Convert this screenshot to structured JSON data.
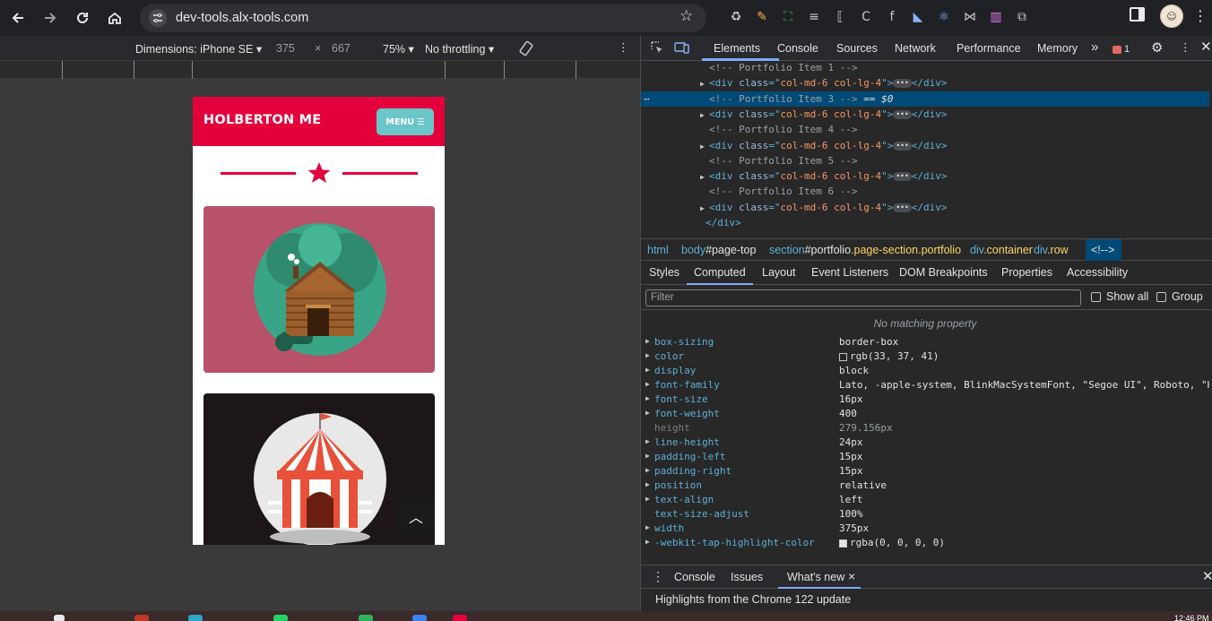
{
  "browser": {
    "url": "dev-tools.alx-tools.com"
  },
  "device_toolbar": {
    "dimensions_label": "Dimensions: iPhone SE",
    "width": "375",
    "times": "×",
    "height": "667",
    "zoom": "75%",
    "throttling": "No throttling"
  },
  "page": {
    "brand": "HOLBERTON ME",
    "menu_label": "MENU",
    "portfolio_colors": [
      "#b8516a",
      "#1c1716"
    ]
  },
  "devtools": {
    "tabs": [
      "Elements",
      "Console",
      "Sources",
      "Network",
      "Performance",
      "Memory"
    ],
    "more_tabs": "»",
    "error_count": "1",
    "dom_lines": [
      {
        "type": "comment",
        "text": "<!-- Portfolio Item 1 -->",
        "indent": 0,
        "arrow": false
      },
      {
        "type": "element",
        "tag": "div",
        "attr": "class",
        "value": "col-md-6 col-lg-4",
        "indent": 0,
        "arrow": true
      },
      {
        "type": "comment",
        "text": "<!-- Portfolio Item 3 -->",
        "suffix": " == $0",
        "indent": 0,
        "arrow": false,
        "selected": true
      },
      {
        "type": "element",
        "tag": "div",
        "attr": "class",
        "value": "col-md-6 col-lg-4",
        "indent": 0,
        "arrow": true
      },
      {
        "type": "comment",
        "text": "<!-- Portfolio Item 4 -->",
        "indent": 0,
        "arrow": false
      },
      {
        "type": "element",
        "tag": "div",
        "attr": "class",
        "value": "col-md-6 col-lg-4",
        "indent": 0,
        "arrow": true
      },
      {
        "type": "comment",
        "text": "<!-- Portfolio Item 5 -->",
        "indent": 0,
        "arrow": false
      },
      {
        "type": "element",
        "tag": "div",
        "attr": "class",
        "value": "col-md-6 col-lg-4",
        "indent": 0,
        "arrow": true
      },
      {
        "type": "comment",
        "text": "<!-- Portfolio Item 6 -->",
        "indent": 0,
        "arrow": false
      },
      {
        "type": "element",
        "tag": "div",
        "attr": "class",
        "value": "col-md-6 col-lg-4",
        "indent": 0,
        "arrow": true
      },
      {
        "type": "close",
        "text": "</div>",
        "indent": -1,
        "arrow": false
      }
    ],
    "breadcrumbs": [
      {
        "tag": "html",
        "id": "",
        "cls": ""
      },
      {
        "tag": "body",
        "id": "#page-top",
        "cls": ""
      },
      {
        "tag": "section",
        "id": "#portfolio",
        "cls": ".page-section.portfolio"
      },
      {
        "tag": "div",
        "id": "",
        "cls": ".container"
      },
      {
        "tag": "div",
        "id": "",
        "cls": ".row"
      }
    ],
    "breadcrumb_selected": "<!-->",
    "sub_tabs": [
      "Styles",
      "Computed",
      "Layout",
      "Event Listeners",
      "DOM Breakpoints",
      "Properties",
      "Accessibility"
    ],
    "filter_placeholder": "Filter",
    "show_all": "Show all",
    "group": "Group",
    "no_matching": "No matching property",
    "computed": [
      {
        "name": "box-sizing",
        "value": "border-box",
        "arrow": true
      },
      {
        "name": "color",
        "value": "rgb(33, 37, 41)",
        "arrow": true,
        "swatch": "#212529"
      },
      {
        "name": "display",
        "value": "block",
        "arrow": true
      },
      {
        "name": "font-family",
        "value": "Lato, -apple-system, BlinkMacSystemFont, \"Segoe UI\", Roboto, \"H",
        "arrow": true
      },
      {
        "name": "font-size",
        "value": "16px",
        "arrow": true
      },
      {
        "name": "font-weight",
        "value": "400",
        "arrow": true
      },
      {
        "name": "height",
        "value": "279.156px",
        "arrow": false,
        "inherited": true
      },
      {
        "name": "line-height",
        "value": "24px",
        "arrow": true
      },
      {
        "name": "padding-left",
        "value": "15px",
        "arrow": true
      },
      {
        "name": "padding-right",
        "value": "15px",
        "arrow": true
      },
      {
        "name": "position",
        "value": "relative",
        "arrow": true
      },
      {
        "name": "text-align",
        "value": "left",
        "arrow": true
      },
      {
        "name": "text-size-adjust",
        "value": "100%",
        "arrow": false
      },
      {
        "name": "width",
        "value": "375px",
        "arrow": true
      },
      {
        "name": "-webkit-tap-highlight-color",
        "value": "rgba(0, 0, 0, 0)",
        "arrow": true,
        "swatch": "checker"
      }
    ],
    "drawer_tabs": [
      "Console",
      "Issues",
      "What's new"
    ],
    "drawer_close": "×",
    "drawer_text": "Highlights from the Chrome 122 update"
  },
  "taskbar": {
    "clock": "12:46 PM"
  }
}
